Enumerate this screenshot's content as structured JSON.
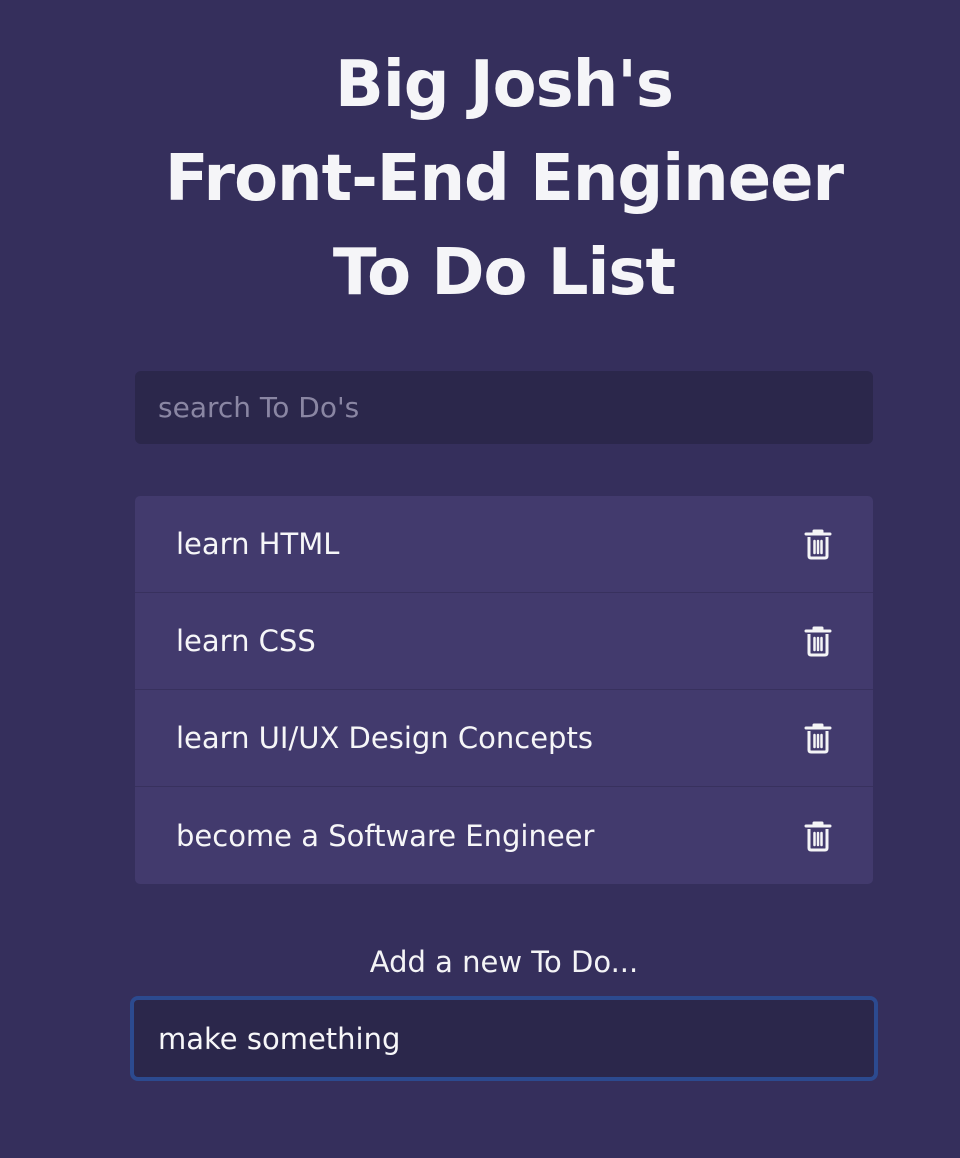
{
  "header": {
    "title_line1": "Big Josh's",
    "title_line2": "Front-End Engineer",
    "title_line3": "To Do List"
  },
  "search": {
    "placeholder": "search To Do's",
    "value": ""
  },
  "todos": [
    {
      "label": "learn HTML",
      "icon": "trash-icon"
    },
    {
      "label": "learn CSS",
      "icon": "trash-icon"
    },
    {
      "label": "learn UI/UX Design Concepts",
      "icon": "trash-icon"
    },
    {
      "label": "become a Software Engineer",
      "icon": "trash-icon"
    }
  ],
  "add": {
    "label": "Add a new To Do...",
    "value": "make something"
  },
  "colors": {
    "background": "#352f5c",
    "input_background": "#2b274b",
    "list_background": "#423a6d",
    "focus_border": "#2c4a8f",
    "text": "#f4f4f6"
  }
}
